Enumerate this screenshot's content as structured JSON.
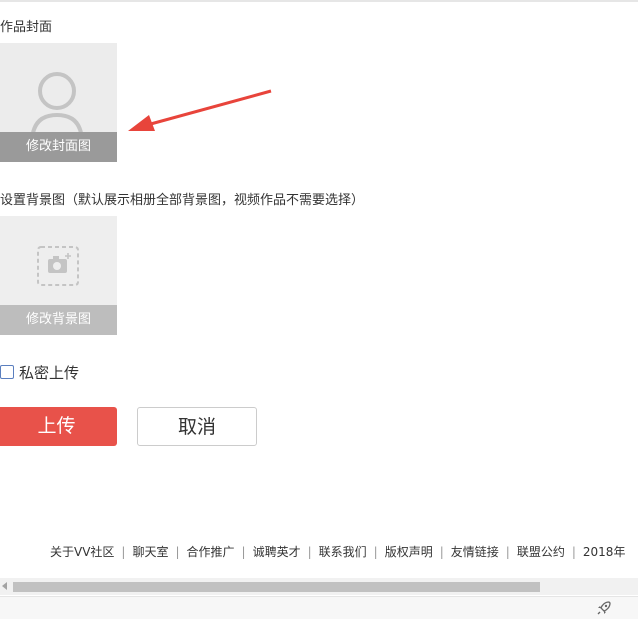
{
  "colors": {
    "accent": "#e8524a",
    "overlay": "#9a9a9a",
    "overlay_light": "#bdbdbd",
    "footer_link": "#333333"
  },
  "cover": {
    "label": "作品封面",
    "button": "修改封面图"
  },
  "background": {
    "label": "设置背景图（默认展示相册全部背景图，视频作品不需要选择）",
    "button": "修改背景图"
  },
  "private_upload": {
    "label": "私密上传",
    "checked": false
  },
  "actions": {
    "upload": "上传",
    "cancel": "取消"
  },
  "footer": {
    "links": [
      "关于VV社区",
      "聊天室",
      "合作推广",
      "诚聘英才",
      "联系我们",
      "版权声明",
      "友情链接",
      "联盟公约",
      "2018年"
    ]
  },
  "icons": {
    "cover_placeholder": "person-avatar-icon",
    "background_placeholder": "camera-add-icon",
    "annotation": "red-arrow-icon",
    "statusbar": "rocket-icon",
    "scroll_left": "scroll-left-arrow-icon"
  }
}
